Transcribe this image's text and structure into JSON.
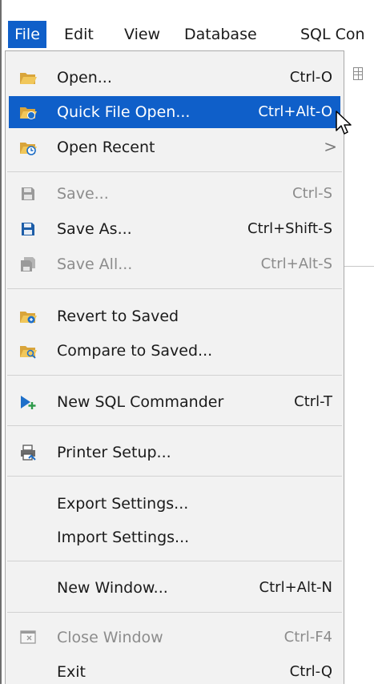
{
  "menubar": {
    "items": [
      {
        "label": "File",
        "active": true
      },
      {
        "label": "Edit"
      },
      {
        "label": "View"
      },
      {
        "label": "Database"
      },
      {
        "label": "SQL Con"
      }
    ]
  },
  "file_menu": {
    "items": [
      {
        "label": "Open...",
        "shortcut": "Ctrl-O",
        "icon": "folder-open-icon"
      },
      {
        "label": "Quick File Open...",
        "shortcut": "Ctrl+Alt-O",
        "icon": "quick-open-folder-icon",
        "highlighted": true
      },
      {
        "label": "Open Recent",
        "shortcut": "",
        "icon": "recent-folder-icon",
        "submenu": true
      },
      {
        "label": "Save...",
        "shortcut": "Ctrl-S",
        "icon": "save-icon",
        "disabled": true
      },
      {
        "label": "Save As...",
        "shortcut": "Ctrl+Shift-S",
        "icon": "save-as-icon"
      },
      {
        "label": "Save All...",
        "shortcut": "Ctrl+Alt-S",
        "icon": "save-all-icon",
        "disabled": true
      },
      {
        "label": "Revert to Saved",
        "shortcut": "",
        "icon": "revert-folder-icon"
      },
      {
        "label": "Compare to Saved...",
        "shortcut": "",
        "icon": "compare-folder-icon"
      },
      {
        "label": "New SQL Commander",
        "shortcut": "Ctrl-T",
        "icon": "new-sql-commander-icon"
      },
      {
        "label": "Printer Setup...",
        "shortcut": "",
        "icon": "printer-icon"
      },
      {
        "label": "Export Settings...",
        "shortcut": ""
      },
      {
        "label": "Import Settings...",
        "shortcut": ""
      },
      {
        "label": "New Window...",
        "shortcut": "Ctrl+Alt-N"
      },
      {
        "label": "Close Window",
        "shortcut": "Ctrl-F4",
        "icon": "close-window-icon",
        "disabled": true
      },
      {
        "label": "Exit",
        "shortcut": "Ctrl-Q"
      }
    ],
    "submenu_arrow": ">"
  },
  "colors": {
    "accent": "#0f5fc9",
    "menu_background": "#f2f2f2",
    "disabled_text": "#8c8c8c",
    "folder_yellow": "#e8b84a",
    "icon_blue": "#1e6fc9"
  }
}
